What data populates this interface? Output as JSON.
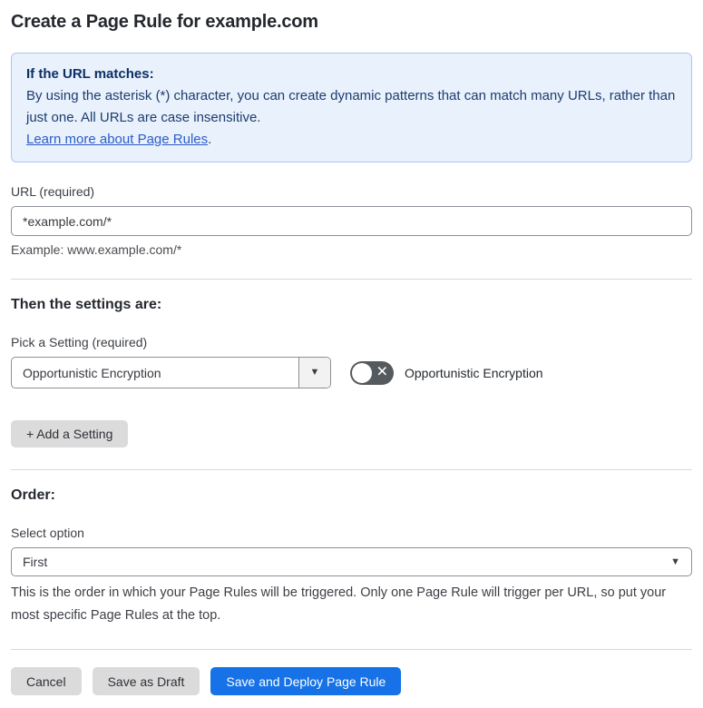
{
  "page": {
    "title": "Create a Page Rule for example.com"
  },
  "info_box": {
    "heading": "If the URL matches:",
    "body": "By using the asterisk (*) character, you can create dynamic patterns that can match many URLs, rather than just one. All URLs are case insensitive.",
    "link_label": "Learn more about Page Rules",
    "link_suffix": "."
  },
  "url_field": {
    "label": "URL (required)",
    "value": "*example.com/*",
    "example": "Example: www.example.com/*"
  },
  "settings_section": {
    "heading": "Then the settings are:",
    "picker_label": "Pick a Setting (required)",
    "selected_setting": "Opportunistic Encryption",
    "toggle_state": "off",
    "toggle_label": "Opportunistic Encryption",
    "add_setting_label": "+ Add a Setting"
  },
  "order_section": {
    "heading": "Order:",
    "select_label": "Select option",
    "selected_option": "First",
    "help_text": "This is the order in which your Page Rules will be triggered. Only one Page Rule will trigger per URL, so put your most specific Page Rules at the top."
  },
  "footer": {
    "cancel_label": "Cancel",
    "save_draft_label": "Save as Draft",
    "save_deploy_label": "Save and Deploy Page Rule"
  },
  "icons": {
    "dropdown_arrow": "▼",
    "toggle_off_x": "✕"
  },
  "colors": {
    "info_bg": "#e8f1fc",
    "info_border": "#a9c8ee",
    "info_heading_text": "#0d2f66",
    "info_body_text": "#1d3c6e",
    "link": "#2c5dc9",
    "primary_button_bg": "#1672e6",
    "gray_button_bg": "#dbdbdb",
    "toggle_off_bg": "#555a5e"
  }
}
